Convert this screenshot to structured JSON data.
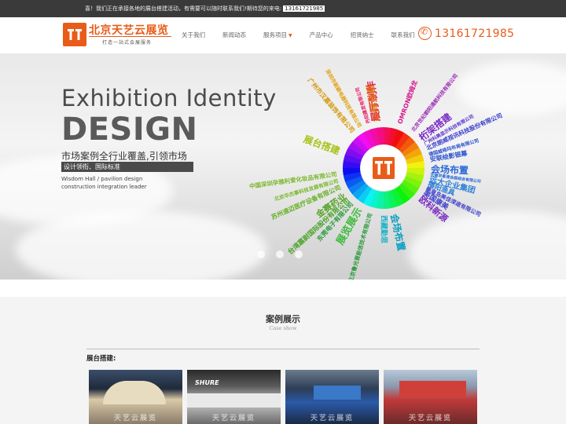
{
  "topbar": {
    "message": "喜！我们正在承接各地的展台搭建活动，有需要可以随时联系我们!期待您的来电:",
    "phone": "13161721985"
  },
  "header": {
    "logo_title": "北京天艺云展览",
    "logo_subtitle": "打造一站式会展服务",
    "phone": "13161721985",
    "nav": [
      {
        "label": "关于我们"
      },
      {
        "label": "新闻动态"
      },
      {
        "label": "服务项目",
        "has_dropdown": true
      },
      {
        "label": "产品中心"
      },
      {
        "label": "招贤纳士"
      },
      {
        "label": "联系我们"
      }
    ]
  },
  "banner": {
    "title_line1": "Exhibition Identity",
    "title_line2": "DESIGN",
    "slogan": "市场案例全行业覆盖,引领市场",
    "tag": "设计领衔、国际标准",
    "en_line1": "Wisdom Hall / pavilion design",
    "en_line2": "construction integration leader",
    "wheel_labels": [
      {
        "text": "展厅制作",
        "color": "#e6195f"
      },
      {
        "text": "丹阳建发有限公司",
        "color": "#e6195f"
      },
      {
        "text": "OMRON欧姆龙",
        "color": "#d6198c"
      },
      {
        "text": "北京世纪朝阳通航科技有限公司",
        "color": "#9b2bb5"
      },
      {
        "text": "桁架搭建",
        "color": "#7b2bc5"
      },
      {
        "text": "广州科美显示科技有限公司",
        "color": "#5a35d0"
      },
      {
        "text": "北京朗威视讯科技股份有限公司",
        "color": "#3a3ecc"
      },
      {
        "text": "德国威格玛布局有限公司",
        "color": "#2c52cf"
      },
      {
        "text": "安联绘影银幕",
        "color": "#2c52cf"
      },
      {
        "text": "会场布置",
        "color": "#2a6ad8"
      },
      {
        "text": "无锡早事清会展综合有限公司",
        "color": "#2a6ad8"
      },
      {
        "text": "远大企业集团",
        "color": "#2a7fd8"
      },
      {
        "text": "播阳渔具",
        "color": "#2a7fd8"
      },
      {
        "text": "秦皇岛美佳滦途有限公司",
        "color": "#3d3ecb"
      },
      {
        "text": "美国康美",
        "color": "#3d3ecb"
      },
      {
        "text": "欧科新源",
        "color": "#7b2bc5"
      },
      {
        "text": "会场布置",
        "color": "#0aa0c0"
      },
      {
        "text": "西藏勤思",
        "color": "#1ab0c8"
      },
      {
        "text": "展览展示",
        "color": "#3dbb3a"
      },
      {
        "text": "北京鲁光晋能信技术有限公司",
        "color": "#2a9a3a"
      },
      {
        "text": "东莞电子有限公司",
        "color": "#2a9a3a"
      },
      {
        "text": "金赛药业",
        "color": "#5aa32a"
      },
      {
        "text": "台湾嘉尉国际股份有限公司",
        "color": "#4ba32a"
      },
      {
        "text": "苏州速迈医疗设备有限公司",
        "color": "#6ab02a"
      },
      {
        "text": "北京华杰事科技发展有限公司",
        "color": "#7ab82a"
      },
      {
        "text": "中国深圳孕雅利爱化妆品有限公司",
        "color": "#7ab82a"
      },
      {
        "text": "展台搭建",
        "color": "#a8c21a"
      },
      {
        "text": "广州市汉嘉装饰有限公司",
        "color": "#d49a10"
      },
      {
        "text": "深圳市新颖电器科技有限公司",
        "color": "#e0a010"
      },
      {
        "text": "展柜制作",
        "color": "#e07010"
      }
    ]
  },
  "cases": {
    "title": "案例展示",
    "subtitle": "Case show",
    "category_label": "展台搭建:",
    "items": [
      {
        "caption": "天艺云展览"
      },
      {
        "caption": "天艺云展览"
      },
      {
        "caption": "天艺云展览"
      },
      {
        "caption": "天艺云展览"
      }
    ]
  },
  "colors": {
    "accent": "#e95b19",
    "topbar": "#3a3a3a"
  }
}
